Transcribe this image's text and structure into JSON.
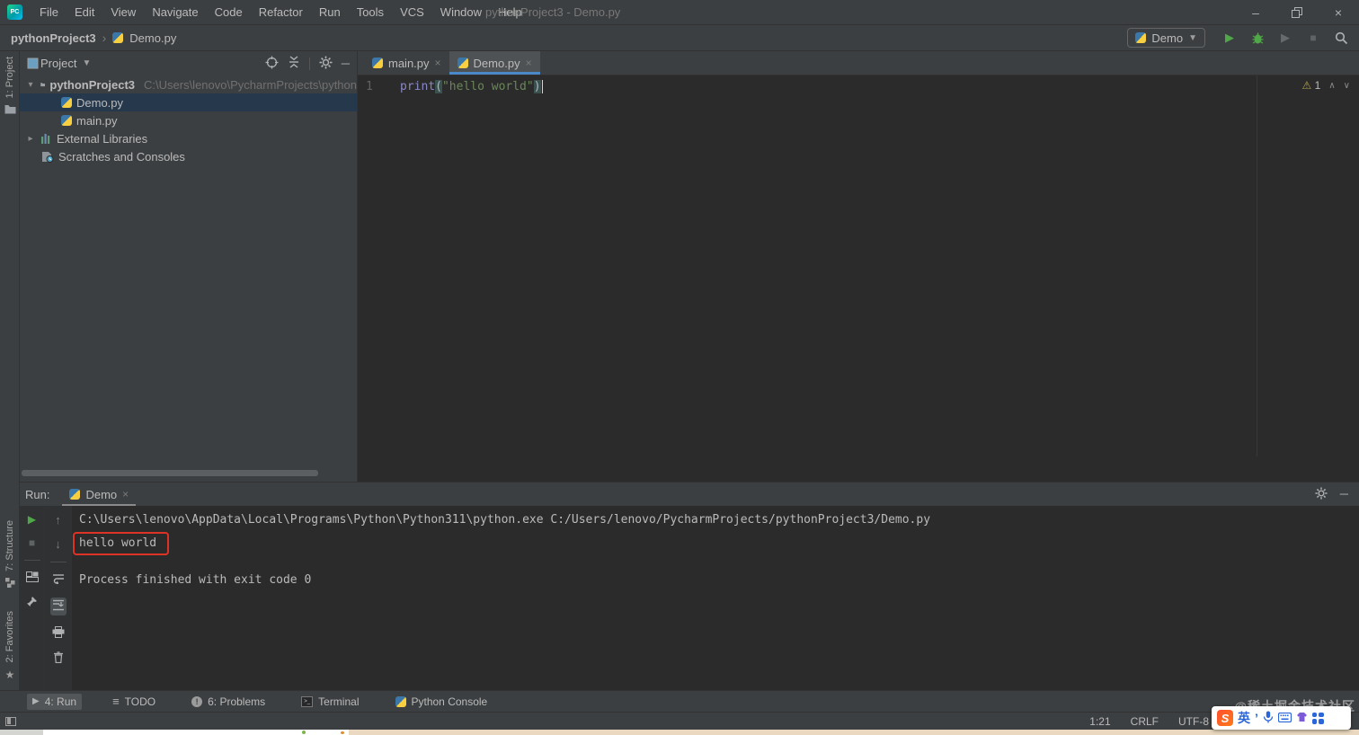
{
  "icons": {
    "window_min": "–",
    "window_close": "×",
    "chevron_breadcrumb": "›",
    "dropdown_arrow": "▼",
    "play": "▶",
    "stop": "■",
    "tree_expanded": "▾",
    "tree_collapsed": "▸",
    "close": "×",
    "warning": "⚠",
    "chevron_up": "∧",
    "chevron_down": "∨",
    "arrow_up": "↑",
    "arrow_down": "↓",
    "star": "★",
    "todo_list": "≡",
    "minimize": "─",
    "problems_mark": "!",
    "terminal_glyph": ">_"
  },
  "title_bar": {
    "app_badge": "PC",
    "menus": [
      "File",
      "Edit",
      "View",
      "Navigate",
      "Code",
      "Refactor",
      "Run",
      "Tools",
      "VCS",
      "Window",
      "Help"
    ],
    "window_title": "pythonProject3 - Demo.py"
  },
  "toolbar": {
    "breadcrumb_root": "pythonProject3",
    "breadcrumb_file": "Demo.py",
    "run_config": "Demo"
  },
  "side_bar": {
    "project": "1: Project",
    "structure": "7: Structure",
    "favorites": "2: Favorites"
  },
  "project_panel": {
    "header": "Project",
    "tree": [
      {
        "label": "pythonProject3",
        "path": "C:\\Users\\lenovo\\PycharmProjects\\python"
      },
      {
        "label": "Demo.py"
      },
      {
        "label": "main.py"
      },
      {
        "label": "External Libraries"
      },
      {
        "label": "Scratches and Consoles"
      }
    ]
  },
  "editor": {
    "tabs": [
      {
        "label": "main.py"
      },
      {
        "label": "Demo.py"
      }
    ],
    "line_number": "1",
    "code": {
      "func": "print",
      "open": "(",
      "string": "\"hello world\"",
      "close": ")"
    },
    "warning_count": "1"
  },
  "run_panel": {
    "label": "Run:",
    "tab": "Demo",
    "console": {
      "line1": "C:\\Users\\lenovo\\AppData\\Local\\Programs\\Python\\Python311\\python.exe C:/Users/lenovo/PycharmProjects/pythonProject3/Demo.py",
      "line2": "hello world",
      "line3": "Process finished with exit code 0"
    }
  },
  "bottom_bar": {
    "run": "4: Run",
    "todo": "TODO",
    "problems": "6: Problems",
    "terminal": "Terminal",
    "python_console": "Python Console"
  },
  "status_bar": {
    "caret": "1:21",
    "line_sep": "CRLF",
    "encoding": "UTF-8"
  },
  "ime": {
    "logo": "S",
    "mode": "英",
    "punct": "’"
  },
  "watermark": "@稀土掘金技术社区",
  "colors": {
    "panel_bg": "#3C3F41",
    "editor_bg": "#2B2B2B",
    "selection": "#26384C",
    "accent_blue": "#4A88C7",
    "run_green": "#4FA748",
    "annotation_red": "#DD3327",
    "string_green": "#6A8759",
    "builtin_purple": "#8888C6"
  }
}
